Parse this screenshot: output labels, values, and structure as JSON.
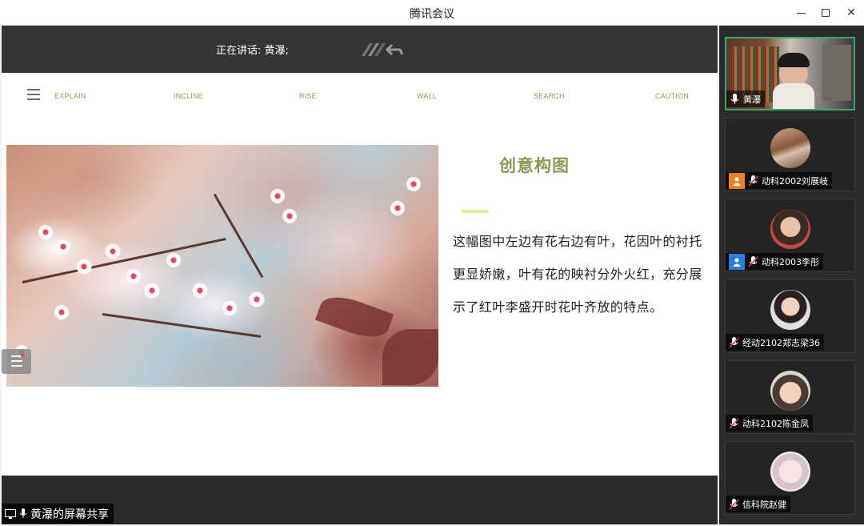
{
  "window": {
    "title": "腾讯会议"
  },
  "share": {
    "speaking_text": "正在讲话: 黄瀑;",
    "label": "黄瀑的屏幕共享"
  },
  "slide": {
    "nav": [
      "EXPLAIN",
      "INCLINE",
      "RISE",
      "WALL",
      "SEARCH",
      "CAUTION"
    ],
    "title": "创意构图",
    "body": "这幅图中左边有花右边有叶，花因叶的衬托更显娇嫩，叶有花的映衬分外火红，充分展示了红叶李盛开时花叶齐放的特点。",
    "photo": "plum-blossom-photo"
  },
  "participants": [
    {
      "name": "黄瀑",
      "mic": "on",
      "active": true
    },
    {
      "name": "动科2002刘展岐",
      "mic": "muted",
      "badge": "orange"
    },
    {
      "name": "动科2003李彤",
      "mic": "muted",
      "badge": "blue"
    },
    {
      "name": "经动2102郑志梁36",
      "mic": "muted"
    },
    {
      "name": "动科2102陈金凤",
      "mic": "muted"
    },
    {
      "name": "信科院赵健",
      "mic": "muted"
    }
  ],
  "colors": {
    "accent_green": "#8a9a56",
    "active_border": "#3aa56b",
    "panel_bg": "#2b2b2b"
  }
}
